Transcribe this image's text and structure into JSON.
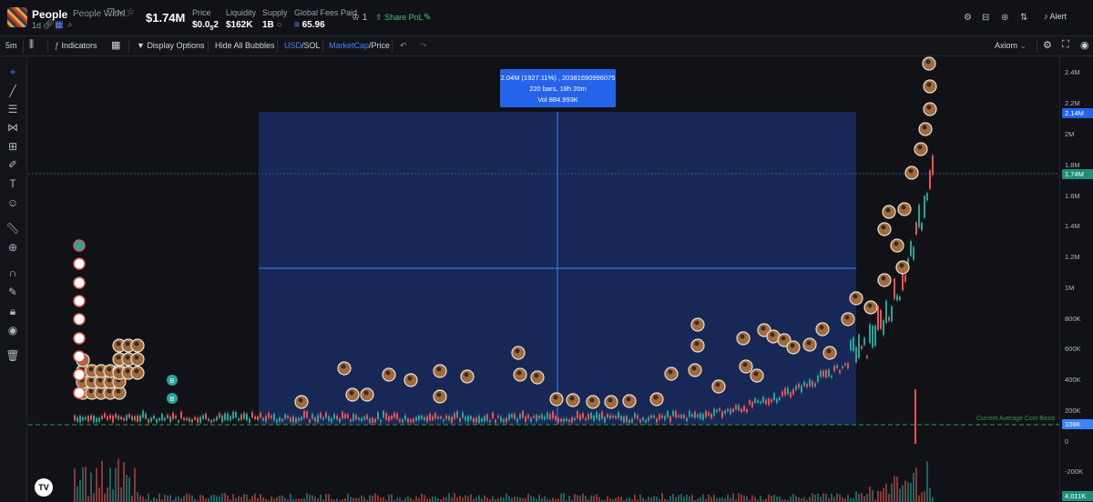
{
  "token": {
    "symbol": "People",
    "full_name": "People With...",
    "age": "1d",
    "market_cap": "$1.74M",
    "stats": [
      {
        "label": "Price",
        "value": "$0.0",
        "sub": "5",
        "value_tail": "2"
      },
      {
        "label": "Liquidity",
        "value": "$162K"
      },
      {
        "label": "Supply",
        "value": "1B"
      },
      {
        "label": "Global Fees Paid",
        "value": "65.96"
      }
    ],
    "watch_count": "1",
    "share_label": "Share PnL",
    "alert_label": "Alert"
  },
  "toolbar": {
    "interval": "5m",
    "indicators": "Indicators",
    "display_options": "Display Options",
    "hide_bubbles": "Hide All Bubbles",
    "currency_usd": "USD",
    "currency_sol": "SOL",
    "metric_mcap": "MarketCap",
    "metric_price": "Price",
    "provider": "Axiom"
  },
  "tooltip": {
    "line1": "2.04M (1927.11%) , 2038169099607­5",
    "line2": "220 bars, 18h 20m",
    "line3": "Vol 884.993K"
  },
  "price_scale": {
    "ticks": [
      "2.4M",
      "2.2M",
      "2M",
      "1.8M",
      "1.6M",
      "1.4M",
      "1.2M",
      "1M",
      "800K",
      "600K",
      "400K",
      "200K",
      "0",
      "-200K"
    ],
    "badges": {
      "measure_top": "2.14M",
      "last": "1.74M",
      "cost_basis": "108K",
      "volume": "4.011K"
    }
  },
  "cost_basis_label": "Current Average Cost Basis",
  "bubble_labels": {
    "buy": "B"
  },
  "tv_logo": "TV",
  "colors": {
    "up": "#26a69a",
    "down": "#ef5350",
    "accent": "#2563eb",
    "basis": "#2e9a4a",
    "selection": "#1e3a8a"
  }
}
